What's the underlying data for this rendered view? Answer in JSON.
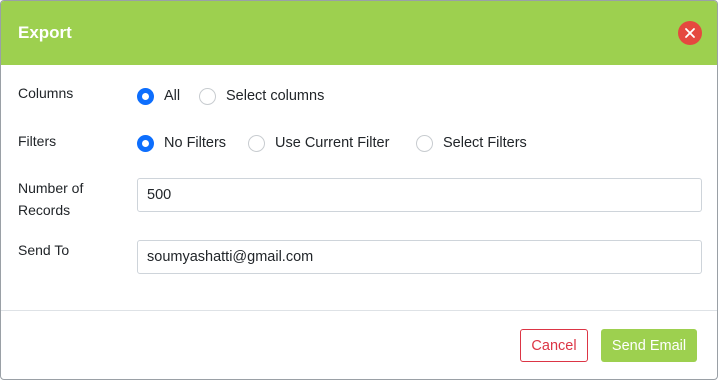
{
  "colors": {
    "accent": "#9dd04f",
    "close": "#e5483f",
    "radio_checked": "#0d6efd",
    "cancel": "#dc3545"
  },
  "dialog": {
    "title": "Export",
    "close_icon": "close-icon"
  },
  "columns": {
    "label": "Columns",
    "options": [
      "All",
      "Select columns"
    ],
    "selected": "All"
  },
  "filters": {
    "label": "Filters",
    "options": [
      "No Filters",
      "Use Current Filter",
      "Select Filters"
    ],
    "selected": "No Filters"
  },
  "records": {
    "label_line1": "Number of",
    "label_line2": "Records",
    "value": "500"
  },
  "send_to": {
    "label": "Send To",
    "value": "soumyashatti@gmail.com"
  },
  "footer": {
    "cancel_label": "Cancel",
    "send_label": "Send Email"
  }
}
